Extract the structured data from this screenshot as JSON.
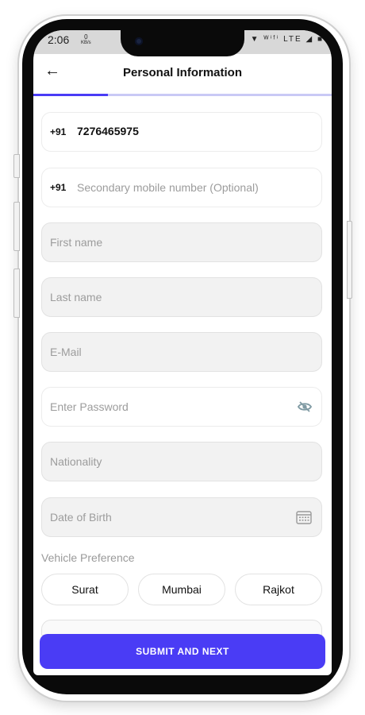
{
  "statusbar": {
    "time": "2:06",
    "kbs_value": "0",
    "kbs_unit": "KB/s",
    "icons": "⇅ ▼ ᵂⁱᶠⁱ LTE ◢ ■"
  },
  "header": {
    "title": "Personal Information",
    "back_icon": "←",
    "progress": 0.25
  },
  "fields": {
    "primary_mobile": {
      "code": "+91",
      "value": "7276465975"
    },
    "secondary_mobile": {
      "code": "+91",
      "placeholder": "Secondary mobile number (Optional)"
    },
    "first_name": {
      "placeholder": "First name"
    },
    "last_name": {
      "placeholder": "Last name"
    },
    "email": {
      "placeholder": "E-Mail"
    },
    "password": {
      "placeholder": "Enter Password"
    },
    "nationality": {
      "placeholder": "Nationality"
    },
    "dob": {
      "placeholder": "Date of Birth"
    }
  },
  "vehicle_preference": {
    "label": "Vehicle Preference",
    "options": [
      "Surat",
      "Mumbai",
      "Rajkot"
    ]
  },
  "submit_label": "SUBMIT AND NEXT",
  "colors": {
    "accent": "#4A3CF5",
    "progress_track": "#C9C9F5"
  }
}
